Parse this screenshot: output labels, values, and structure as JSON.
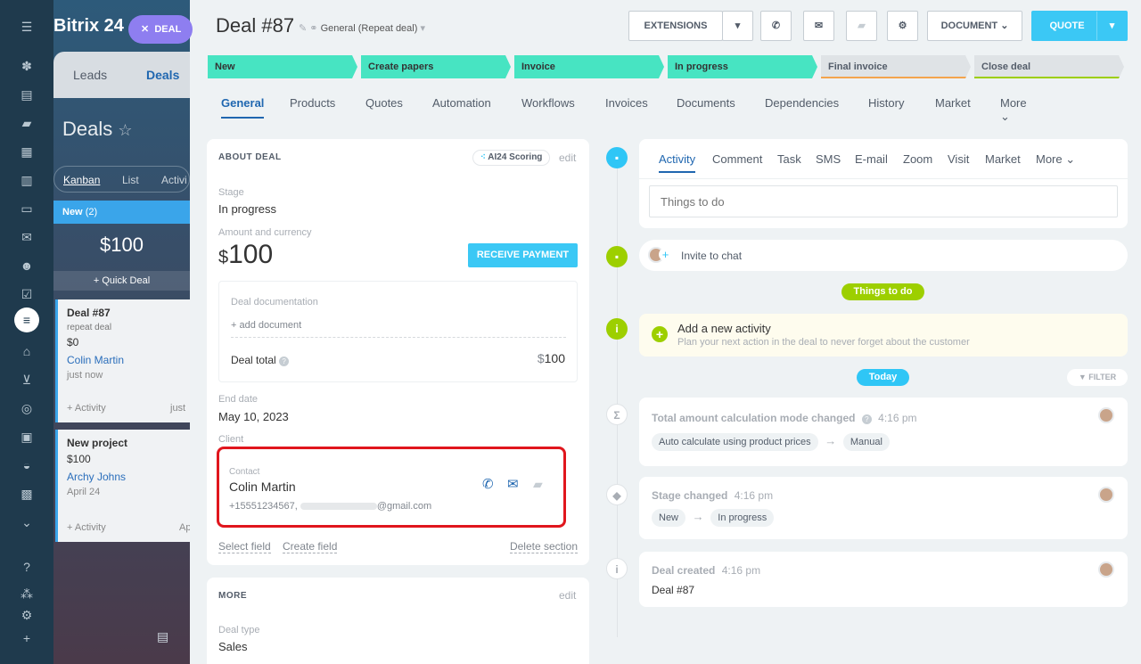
{
  "app": {
    "logo": "Bitrix 24"
  },
  "rail": {
    "icons": [
      "menu-icon",
      "feed-icon",
      "tasks-icon",
      "chat-icon",
      "calendar-icon",
      "docs-icon",
      "drive-icon",
      "mail-icon",
      "groups-icon",
      "checklist-icon",
      "crm-icon",
      "store-icon",
      "cart-icon",
      "target-icon",
      "contacts-icon",
      "robot-icon",
      "box-icon",
      "more-icon",
      "help-icon",
      "sitemap-icon",
      "settings-icon",
      "add-icon"
    ]
  },
  "background": {
    "deal_pill": "DEAL",
    "tabs": [
      "Leads",
      "Deals"
    ],
    "title": "Deals",
    "view_tabs": [
      "Kanban",
      "List",
      "Activi"
    ],
    "column": {
      "name": "New",
      "count": "(2)",
      "sum": "$100",
      "quick": "+ Quick Deal"
    },
    "cards": [
      {
        "title": "Deal #87",
        "sub": "repeat deal",
        "amount": "$0",
        "contact": "Colin Martin",
        "time": "just now",
        "activity": "+ Activity",
        "extra": "just"
      },
      {
        "title": "New project",
        "amount": "$100",
        "contact": "Archy Johns",
        "time": "April 24",
        "activity": "+ Activity",
        "extra": "Ap"
      }
    ]
  },
  "header": {
    "title": "Deal #87",
    "subtitle": "General (Repeat deal)",
    "buttons": {
      "extensions": "EXTENSIONS",
      "document": "DOCUMENT",
      "quote": "QUOTE"
    }
  },
  "stages": [
    {
      "label": "New",
      "color": "#47e4c2"
    },
    {
      "label": "Create papers",
      "color": "#47e4c2"
    },
    {
      "label": "Invoice",
      "color": "#47e4c2"
    },
    {
      "label": "In progress",
      "color": "#47e4c2"
    },
    {
      "label": "Final invoice",
      "color": "#dfe3e6"
    },
    {
      "label": "Close deal",
      "color": "#dfe3e6"
    }
  ],
  "tabs": [
    "General",
    "Products",
    "Quotes",
    "Automation",
    "Workflows",
    "Invoices",
    "Documents",
    "Dependencies",
    "History",
    "Market",
    "More"
  ],
  "about": {
    "title": "ABOUT DEAL",
    "scoring": "AI24 Scoring",
    "edit": "edit",
    "stage_label": "Stage",
    "stage_value": "In progress",
    "amount_label": "Amount and currency",
    "amount_symbol": "$",
    "amount_value": "100",
    "receive_payment": "RECEIVE PAYMENT",
    "doc_label": "Deal documentation",
    "add_document": "+ add document",
    "deal_total_label": "Deal total",
    "deal_total_symbol": "$",
    "deal_total_value": "100",
    "end_date_label": "End date",
    "end_date_value": "May 10, 2023",
    "client_label": "Client",
    "contact_label": "Contact",
    "contact_name": "Colin Martin",
    "contact_phone": "+15551234567,",
    "contact_email": "@gmail.com",
    "select_field": "Select field",
    "create_field": "Create field",
    "delete_section": "Delete section"
  },
  "more": {
    "title": "MORE",
    "edit": "edit",
    "deal_type_label": "Deal type",
    "deal_type_value": "Sales"
  },
  "activity": {
    "tabs": [
      "Activity",
      "Comment",
      "Task",
      "SMS",
      "E-mail",
      "Zoom",
      "Visit",
      "Market",
      "More"
    ],
    "placeholder": "Things to do",
    "invite": "Invite to chat",
    "things_badge": "Things to do",
    "add_title": "Add a new activity",
    "add_sub": "Plan your next action in the deal to never forget about the customer",
    "today_badge": "Today",
    "filter": "FILTER",
    "events": [
      {
        "title": "Total amount calculation mode changed",
        "time": "4:16 pm",
        "from": "Auto calculate using product prices",
        "to": "Manual"
      },
      {
        "title": "Stage changed",
        "time": "4:16 pm",
        "from": "New",
        "to": "In progress"
      },
      {
        "title": "Deal created",
        "time": "4:16 pm",
        "body": "Deal #87"
      }
    ]
  }
}
